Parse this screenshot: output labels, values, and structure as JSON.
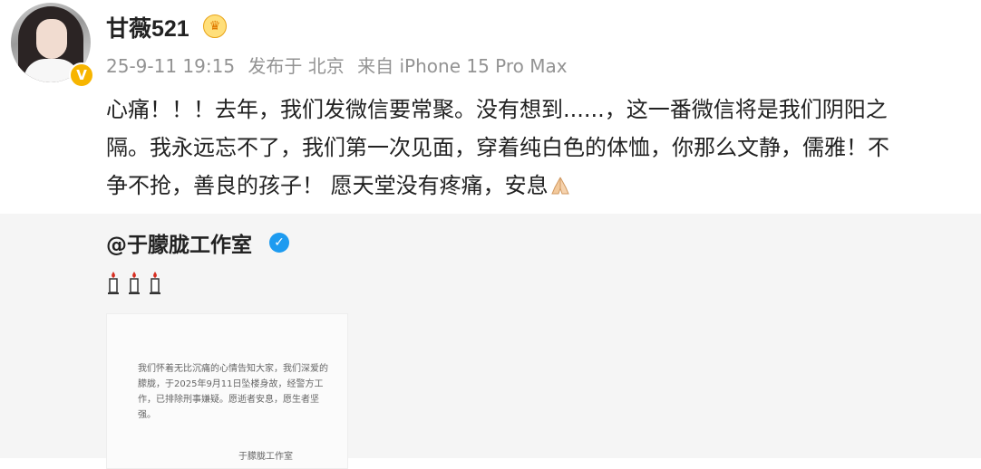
{
  "post": {
    "username": "甘薇521",
    "avatar": "avatar",
    "badges": {
      "member_badge_icon": "crown-icon",
      "verified_icon": "yellow-v-icon"
    },
    "meta": {
      "timestamp": "25-9-11 19:15",
      "location": "发布于 北京",
      "device": "来自 iPhone 15 Pro Max"
    },
    "content": {
      "lines": [
        "心痛！！！去年，我们发微信要常聚。没有想到......，这一番微信将是我们阴阳之",
        "隔。我永远忘不了，我们第一次见面，穿着纯白色的体恤，你那么文静，儒雅！不",
        "争不抢，善良的孩子！ 愿天堂没有疼痛，安息"
      ],
      "emoji": "praying-hands-icon"
    }
  },
  "repost": {
    "username": "@于朦胧工作室",
    "verified_icon": "blue-v-icon",
    "candles": "candle-icon x3",
    "notice": {
      "text": "我们怀着无比沉痛的心情告知大家，我们深爱的朦胧，于2025年9月11日坠楼身故，经警方工作，已排除刑事嫌疑。愿逝者安息，愿生者坚强。",
      "signature": "于朦胧工作室"
    }
  },
  "colors": {
    "background": "#ffffff",
    "repost_background": "#f5f5f5",
    "text": "#222222",
    "meta_text": "#939393",
    "verified_yellow": "#f7b500",
    "verified_blue": "#1d9bf0"
  }
}
